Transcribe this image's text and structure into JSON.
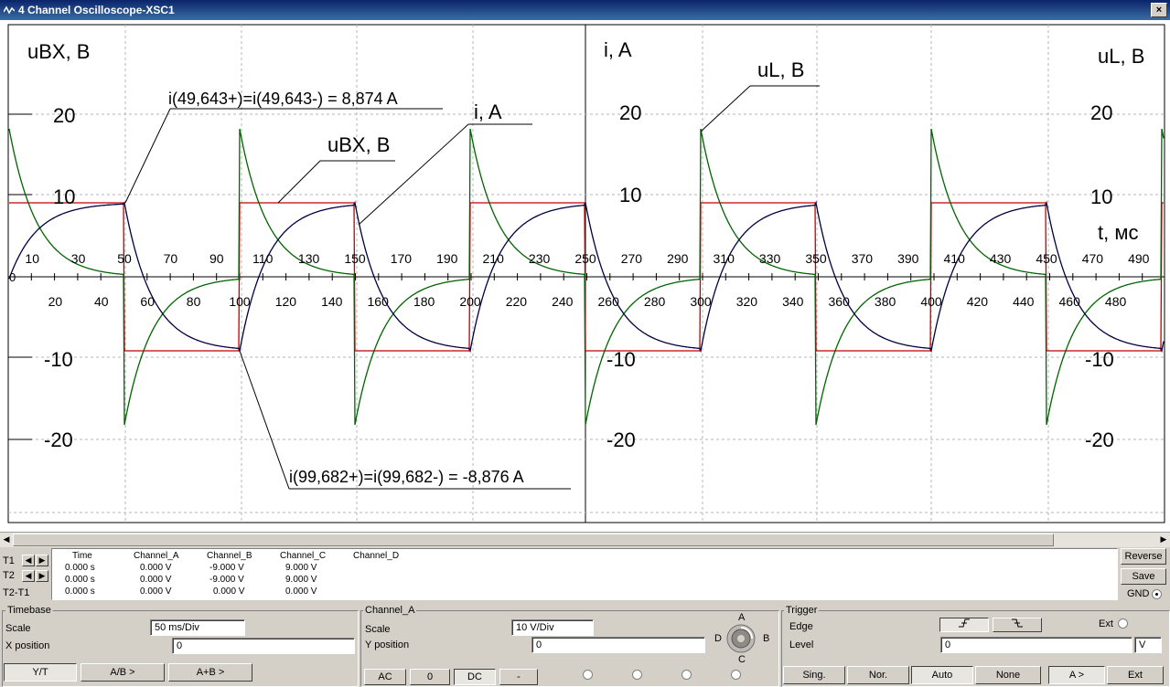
{
  "window": {
    "title": "4 Channel Oscilloscope-XSC1",
    "close_label": "×"
  },
  "screen": {
    "left": {
      "axis_title_tl": "uBX, B",
      "y_ticks": [
        "20",
        "10",
        "-10",
        "-20"
      ],
      "x_ticks_top": [
        "10",
        "30",
        "50",
        "70",
        "90",
        "110",
        "130",
        "150",
        "170",
        "190",
        "210",
        "230",
        "250"
      ],
      "x_ticks_bottom": [
        "20",
        "40",
        "60",
        "80",
        "100",
        "120",
        "140",
        "160",
        "180",
        "200",
        "220",
        "240"
      ],
      "zero_label": "0"
    },
    "right": {
      "axis_title_tl": "i, A",
      "axis_title_tr": "uL, B",
      "axis_title_time": "t, мс",
      "y_ticks_left": [
        "20",
        "10",
        "-10",
        "-20"
      ],
      "y_ticks_right": [
        "20",
        "10",
        "-10",
        "-20"
      ],
      "x_ticks_top": [
        "270",
        "290",
        "310",
        "330",
        "350",
        "370",
        "390",
        "410",
        "430",
        "450",
        "470",
        "490"
      ],
      "x_ticks_bottom": [
        "260",
        "280",
        "300",
        "320",
        "340",
        "360",
        "380",
        "400",
        "420",
        "440",
        "460",
        "480"
      ]
    },
    "annotations": {
      "a1": "i(49,643+)=i(49,643-) = 8,874 A",
      "a2": "uBX, B",
      "a3": "i, A",
      "a4": "uL, B",
      "a5": "i(99,682+)=i(99,682-) = -8,876 A"
    }
  },
  "cursor_panel": {
    "t1_label": "T1",
    "t2_label": "T2",
    "diff_label": "T2-T1",
    "headers": [
      "Time",
      "Channel_A",
      "Channel_B",
      "Channel_C",
      "Channel_D"
    ],
    "rows": [
      [
        "0.000 s",
        "0.000 V",
        "-9.000 V",
        "9.000 V",
        ""
      ],
      [
        "0.000 s",
        "0.000 V",
        "-9.000 V",
        "9.000 V",
        ""
      ],
      [
        "0.000 s",
        "0.000 V",
        "0.000 V",
        "0.000 V",
        ""
      ]
    ],
    "reverse_label": "Reverse",
    "save_label": "Save",
    "gnd_label": "GND"
  },
  "timebase": {
    "title": "Timebase",
    "scale_label": "Scale",
    "scale_value": "50 ms/Div",
    "xpos_label": "X position",
    "xpos_value": "0",
    "buttons": [
      "Y/T",
      "A/B >",
      "A+B >"
    ]
  },
  "channel": {
    "title": "Channel_A",
    "scale_label": "Scale",
    "scale_value": "10  V/Div",
    "ypos_label": "Y position",
    "ypos_value": "0",
    "buttons": [
      "AC",
      "0",
      "DC",
      "-"
    ],
    "knob": {
      "a": "A",
      "b": "B",
      "c": "C",
      "d": "D"
    }
  },
  "trigger": {
    "title": "Trigger",
    "edge_label": "Edge",
    "ext_label": "Ext",
    "level_label": "Level",
    "level_value": "0",
    "level_unit": "V",
    "buttons": [
      "Sing.",
      "Nor.",
      "Auto",
      "None",
      "A >",
      "Ext"
    ]
  }
}
